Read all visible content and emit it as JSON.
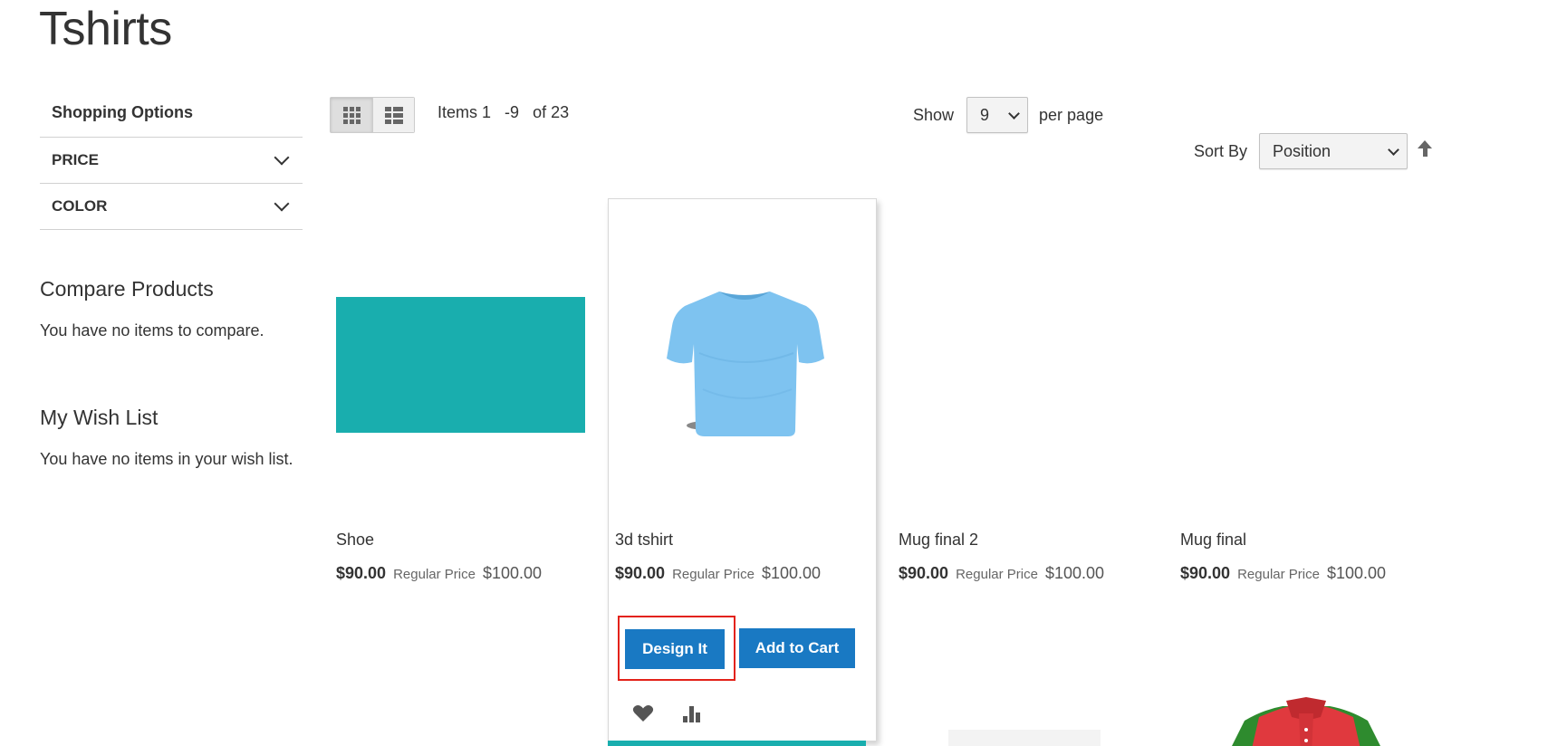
{
  "page": {
    "title": "Tshirts"
  },
  "sidebar": {
    "shopping_options": "Shopping Options",
    "filters": [
      {
        "label": "PRICE"
      },
      {
        "label": "COLOR"
      }
    ],
    "compare": {
      "title": "Compare Products",
      "text": "You have no items to compare."
    },
    "wishlist": {
      "title": "My Wish List",
      "text": "You have no items in your wish list."
    }
  },
  "toolbar": {
    "amount": {
      "prefix": "Items 1",
      "to": "-9",
      "total": "of 23"
    },
    "limiter": {
      "show": "Show",
      "value": "9",
      "per_page": "per page"
    },
    "sorter": {
      "label": "Sort By",
      "value": "Position"
    }
  },
  "products": [
    {
      "name": "Shoe",
      "final_price": "$90.00",
      "regular_label": "Regular Price",
      "regular_price": "$100.00"
    },
    {
      "name": "3d tshirt",
      "final_price": "$90.00",
      "regular_label": "Regular Price",
      "regular_price": "$100.00",
      "design_label": "Design It",
      "cart_label": "Add to Cart"
    },
    {
      "name": "Mug final 2",
      "final_price": "$90.00",
      "regular_label": "Regular Price",
      "regular_price": "$100.00"
    },
    {
      "name": "Mug final",
      "final_price": "$90.00",
      "regular_label": "Regular Price",
      "regular_price": "$100.00"
    }
  ],
  "colors": {
    "primary_button": "#1979c3",
    "highlight": "#e32219",
    "teal": "#19aeae",
    "tshirt": "#7ec3f0"
  },
  "icons": {
    "grid": "grid-icon",
    "list": "list-icon",
    "heart": "heart-icon",
    "compare": "bar-chart-icon",
    "sort": "arrow-up-icon"
  }
}
